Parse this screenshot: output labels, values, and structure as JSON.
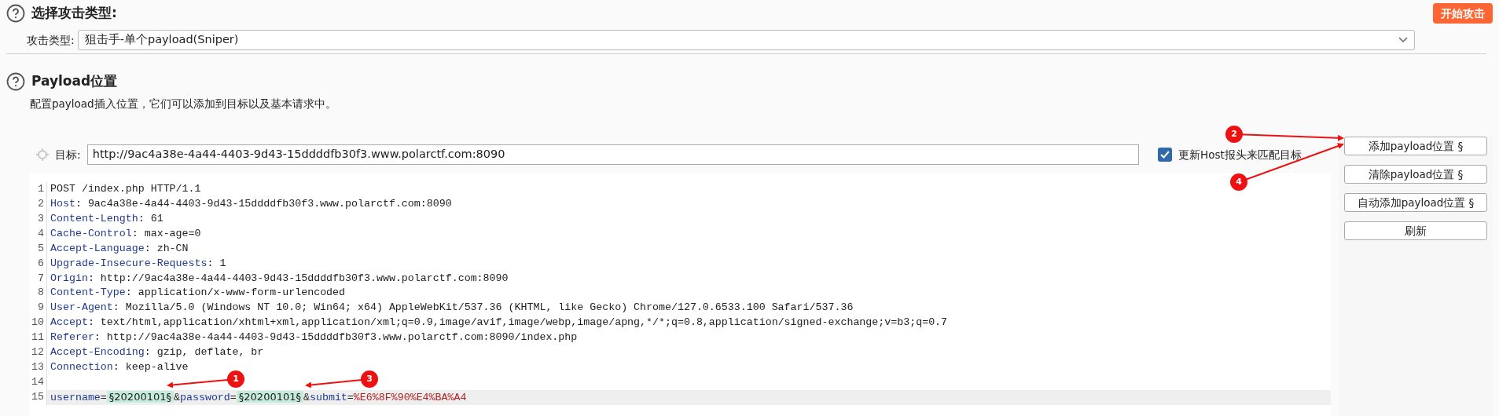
{
  "attack_section": {
    "title": "选择攻击类型:",
    "start_button": "开始攻击",
    "attack_type_label": "攻击类型:",
    "attack_type_value": "狙击手-单个payload(Sniper)"
  },
  "positions_section": {
    "title": "Payload位置",
    "description": "配置payload插入位置，它们可以添加到目标以及基本请求中。",
    "target_label": "目标:",
    "target_value": "http://9ac4a38e-4a44-4403-9d43-15ddddfb30f3.www.polarctf.com:8090",
    "update_host": {
      "label": "更新Host报头来匹配目标",
      "checked": true
    },
    "buttons": [
      "添加payload位置 §",
      "清除payload位置 §",
      "自动添加payload位置 §",
      "刷新"
    ],
    "request_lines": [
      {
        "number": "1",
        "highlighted": false,
        "segments": [
          {
            "kind": "plain",
            "text": "POST /index.php HTTP/1.1"
          }
        ]
      },
      {
        "number": "2",
        "highlighted": false,
        "segments": [
          {
            "kind": "name",
            "text": "Host"
          },
          {
            "kind": "plain",
            "text": ": 9ac4a38e-4a44-4403-9d43-15ddddfb30f3.www.polarctf.com:8090"
          }
        ]
      },
      {
        "number": "3",
        "highlighted": false,
        "segments": [
          {
            "kind": "name",
            "text": "Content-Length"
          },
          {
            "kind": "plain",
            "text": ": 61"
          }
        ]
      },
      {
        "number": "4",
        "highlighted": false,
        "segments": [
          {
            "kind": "name",
            "text": "Cache-Control"
          },
          {
            "kind": "plain",
            "text": ": max-age=0"
          }
        ]
      },
      {
        "number": "5",
        "highlighted": false,
        "segments": [
          {
            "kind": "name",
            "text": "Accept-Language"
          },
          {
            "kind": "plain",
            "text": ": zh-CN"
          }
        ]
      },
      {
        "number": "6",
        "highlighted": false,
        "segments": [
          {
            "kind": "name",
            "text": "Upgrade-Insecure-Requests"
          },
          {
            "kind": "plain",
            "text": ": 1"
          }
        ]
      },
      {
        "number": "7",
        "highlighted": false,
        "segments": [
          {
            "kind": "name",
            "text": "Origin"
          },
          {
            "kind": "plain",
            "text": ": http://9ac4a38e-4a44-4403-9d43-15ddddfb30f3.www.polarctf.com:8090"
          }
        ]
      },
      {
        "number": "8",
        "highlighted": false,
        "segments": [
          {
            "kind": "name",
            "text": "Content-Type"
          },
          {
            "kind": "plain",
            "text": ": application/x-www-form-urlencoded"
          }
        ]
      },
      {
        "number": "9",
        "highlighted": false,
        "segments": [
          {
            "kind": "name",
            "text": "User-Agent"
          },
          {
            "kind": "plain",
            "text": ": Mozilla/5.0 (Windows NT 10.0; Win64; x64) AppleWebKit/537.36 (KHTML, like Gecko) Chrome/127.0.6533.100 Safari/537.36"
          }
        ]
      },
      {
        "number": "10",
        "highlighted": false,
        "segments": [
          {
            "kind": "name",
            "text": "Accept"
          },
          {
            "kind": "plain",
            "text": ": text/html,application/xhtml+xml,application/xml;q=0.9,image/avif,image/webp,image/apng,*/*;q=0.8,application/signed-exchange;v=b3;q=0.7"
          }
        ]
      },
      {
        "number": "11",
        "highlighted": false,
        "segments": [
          {
            "kind": "name",
            "text": "Referer"
          },
          {
            "kind": "plain",
            "text": ": http://9ac4a38e-4a44-4403-9d43-15ddddfb30f3.www.polarctf.com:8090/index.php"
          }
        ]
      },
      {
        "number": "12",
        "highlighted": false,
        "segments": [
          {
            "kind": "name",
            "text": "Accept-Encoding"
          },
          {
            "kind": "plain",
            "text": ": gzip, deflate, br"
          }
        ]
      },
      {
        "number": "13",
        "highlighted": false,
        "segments": [
          {
            "kind": "name",
            "text": "Connection"
          },
          {
            "kind": "plain",
            "text": ": keep-alive"
          }
        ]
      },
      {
        "number": "14",
        "highlighted": false
      },
      {
        "number": "15",
        "highlighted": true,
        "segments": [
          {
            "kind": "name",
            "text": "username"
          },
          {
            "kind": "plain",
            "text": "="
          },
          {
            "kind": "payload",
            "text": "§20200101§"
          },
          {
            "kind": "plain",
            "text": "&"
          },
          {
            "kind": "name",
            "text": "password"
          },
          {
            "kind": "plain",
            "text": "="
          },
          {
            "kind": "payload",
            "text": "§20200101§"
          },
          {
            "kind": "plain",
            "text": "&"
          },
          {
            "kind": "name",
            "text": "submit"
          },
          {
            "kind": "plain",
            "text": "="
          },
          {
            "kind": "value",
            "text": "%E6%8F%90%E4%BA%A4"
          }
        ]
      }
    ]
  },
  "annotations": [
    {
      "label": "1"
    },
    {
      "label": "2"
    },
    {
      "label": "3"
    },
    {
      "label": "4"
    }
  ]
}
